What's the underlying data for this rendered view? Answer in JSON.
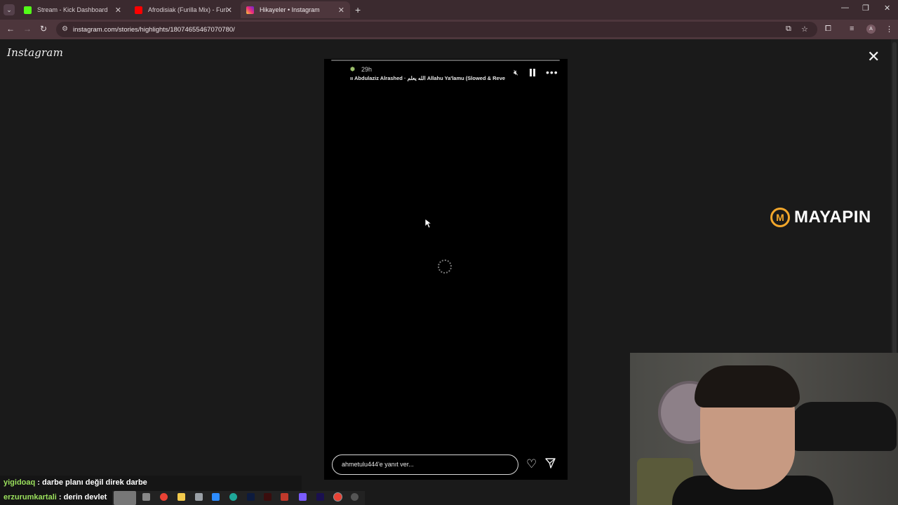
{
  "browser": {
    "tabs": [
      {
        "title": "Stream - Kick Dashboard",
        "favicon_color": "#53fc18",
        "active": false
      },
      {
        "title": "Afrodisiak (Furilla Mix) - Furilla",
        "favicon_color": "#ff0000",
        "active": false
      },
      {
        "title": "Hikayeler • Instagram",
        "favicon_color": "#e1306c",
        "active": true
      }
    ],
    "url": "instagram.com/stories/highlights/18074655467070780/",
    "profile_initial": "A"
  },
  "instagram": {
    "logo": "Instagram",
    "story": {
      "time_ago": "29h",
      "music": "Abdulaziz Alrashed · الله يعلم Allahu Ya'lamu (Slowed & Reve",
      "reply_placeholder": "ahmetulu444'e yanıt ver..."
    }
  },
  "overlay": {
    "brand": "MAYAPIN",
    "brand_color": "#f3a72b",
    "chat": [
      {
        "user": "yigidoaq",
        "message": "darbe planı değil direk darbe"
      },
      {
        "user": "erzurumkartali",
        "message": "derin devlet"
      }
    ]
  },
  "icons": {
    "close": "close-icon",
    "mute": "mute-icon",
    "pause": "pause-icon",
    "more": "more-icon",
    "heart": "heart-icon",
    "send": "send-icon"
  }
}
